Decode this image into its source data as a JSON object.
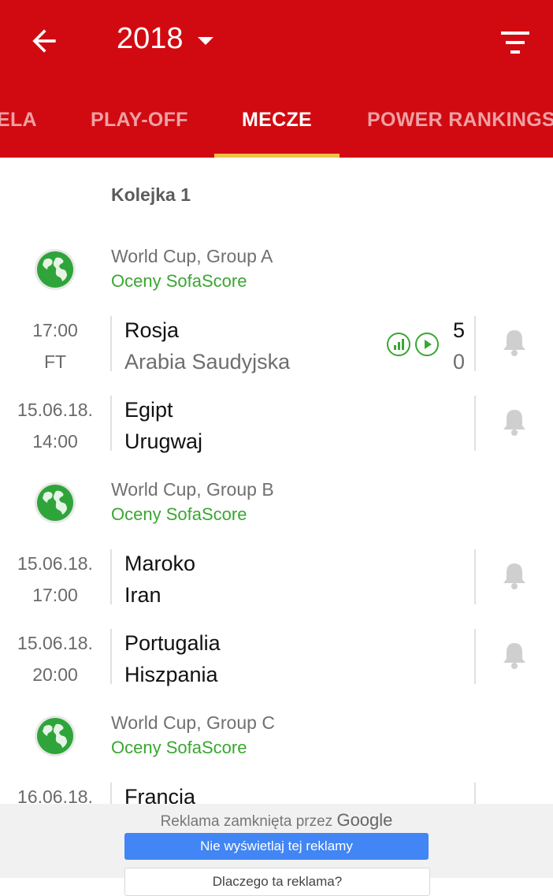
{
  "appbar": {
    "year": "2018",
    "tabs": [
      "ELA",
      "PLAY-OFF",
      "MECZE",
      "POWER RANKINGS"
    ],
    "active_tab": "MECZE",
    "background": "#d10a11",
    "indicator_color": "#f2c04a"
  },
  "section": {
    "title": "Kolejka 1"
  },
  "leagues": [
    {
      "name": "World Cup, Group A",
      "rating": "Oceny SofaScore",
      "matches": [
        {
          "time1": "17:00",
          "time2": "FT",
          "home": "Rosja",
          "away": "Arabia Saudyjska",
          "home_score": "5",
          "away_score": "0",
          "icons": [
            "stats-icon",
            "play-icon"
          ]
        },
        {
          "time1": "15.06.18.",
          "time2": "14:00",
          "home": "Egipt",
          "away": "Urugwaj"
        }
      ]
    },
    {
      "name": "World Cup, Group B",
      "rating": "Oceny SofaScore",
      "matches": [
        {
          "time1": "15.06.18.",
          "time2": "17:00",
          "home": "Maroko",
          "away": "Iran"
        },
        {
          "time1": "15.06.18.",
          "time2": "20:00",
          "home": "Portugalia",
          "away": "Hiszpania"
        }
      ]
    },
    {
      "name": "World Cup, Group C",
      "rating": "Oceny SofaScore",
      "matches": [
        {
          "time1": "16.06.18.",
          "home": "Francja"
        }
      ]
    }
  ],
  "ad": {
    "closed_text": "Reklama zamknięta przez",
    "brand": "Google",
    "button": "Nie wyświetlaj tej reklamy",
    "button2": "Dlaczego ta reklama?"
  },
  "colors": {
    "accent_green": "#3aa632",
    "text_gray": "#6e6e6e"
  }
}
